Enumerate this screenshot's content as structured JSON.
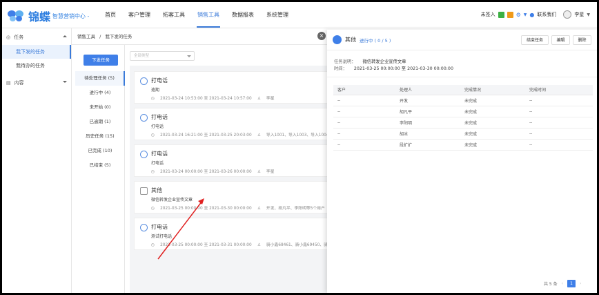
{
  "header": {
    "brand": "锦蝶",
    "subtitle": "智慧营销中心 -",
    "nav": [
      "首页",
      "客户管理",
      "拓客工具",
      "销售工具",
      "数据报表",
      "系统管理"
    ],
    "active_nav": "销售工具",
    "checkin": "未签入",
    "contact": "联系我们",
    "user": "李星"
  },
  "sidebar": {
    "groups": [
      {
        "label": "任务",
        "items": [
          "我下发的任务",
          "我待办的任务"
        ]
      },
      {
        "label": "内容",
        "items": []
      }
    ],
    "active_item": "我下发的任务"
  },
  "breadcrumb": {
    "root": "销售工具",
    "sep": "/",
    "current": "我下发的任务"
  },
  "tasks_panel": {
    "primary_button": "下发任务",
    "filter_placeholder": "全部类型",
    "groups": [
      {
        "label": "待处理任务 (5)",
        "active": true
      },
      {
        "label": "进行中 (4)"
      },
      {
        "label": "未开始 (0)"
      },
      {
        "label": "已逾期 (1)"
      },
      {
        "label": "历史任务 (15)"
      },
      {
        "label": "已完成 (10)"
      },
      {
        "label": "已结束 (5)"
      }
    ]
  },
  "cards": [
    {
      "title": "打电话",
      "desc": "逾期",
      "time": "2021-03-24 10:53:00 至 2021-03-24 10:57:00",
      "people": "李星",
      "icon": "phone-circle-icon"
    },
    {
      "title": "打电话",
      "desc": "打电话",
      "time": "2021-03-24 16:21:00 至 2021-03-25 20:03:00",
      "people": "导入1001、导入1003、导入1004等",
      "icon": "phone-circle-icon"
    },
    {
      "title": "打电话",
      "desc": "打电话",
      "time": "2021-03-24 00:00:00 至 2021-03-26 00:00:00",
      "people": "李星",
      "icon": "phone-circle-icon"
    },
    {
      "title": "其他",
      "desc": "微信转发企业宣传文章",
      "time": "2021-03-25 00:00:00 至 2021-03-30 00:00:00",
      "people": "开发、胡凡平、李阳明等5个用户",
      "icon": "other-task-icon"
    },
    {
      "title": "打电话",
      "desc": "测试打电话",
      "time": "2021-03-25 00:00:00 至 2021-03-31 00:00:00",
      "people": "骑小鑫68461、骑小鑫69450、骑小",
      "icon": "phone-circle-icon"
    }
  ],
  "drawer": {
    "title": "其他",
    "status": "进行中 ( 0 / 5 )",
    "buttons": [
      "结束任务",
      "编辑",
      "删除"
    ],
    "desc_label": "任务说明：",
    "desc_value": "微信转发企业宣传文章",
    "time_label": "时间：",
    "time_value": "2021-03-25 00:00:00 至 2021-03-30 00:00:00",
    "table": {
      "headers": [
        "客户",
        "处理人",
        "完成情况",
        "完成时间"
      ],
      "rows": [
        [
          "--",
          "开发",
          "未完成",
          "--"
        ],
        [
          "--",
          "胡凡平",
          "未完成",
          "--"
        ],
        [
          "--",
          "李阳明",
          "未完成",
          "--"
        ],
        [
          "--",
          "胡冰",
          "未完成",
          "--"
        ],
        [
          "--",
          "段扩扩",
          "未完成",
          "--"
        ]
      ]
    },
    "pager": {
      "total": "共 5 条",
      "page": "1"
    }
  },
  "colors": {
    "primary": "#3f7fe8",
    "annotation_arrow": "#e02020"
  }
}
